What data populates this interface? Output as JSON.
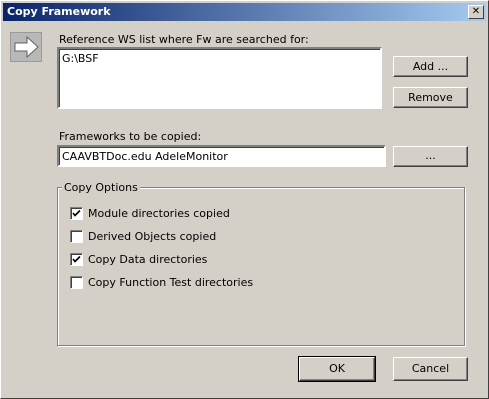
{
  "window": {
    "title": "Copy Framework",
    "close_glyph": "✕"
  },
  "reference": {
    "label": "Reference WS list where Fw are searched for:",
    "entries": [
      "G:\\BSF"
    ],
    "add_button": "Add ...",
    "remove_button": "Remove"
  },
  "frameworks": {
    "label": "Frameworks to be copied:",
    "value": "CAAVBTDoc.edu AdeleMonitor",
    "browse_button": "..."
  },
  "copy_options": {
    "label": "Copy Options",
    "items": [
      {
        "label": "Module directories copied",
        "checked": true
      },
      {
        "label": "Derived Objects copied",
        "checked": false
      },
      {
        "label": "Copy Data directories",
        "checked": true
      },
      {
        "label": "Copy Function Test directories",
        "checked": false
      }
    ]
  },
  "footer": {
    "ok_button": "OK",
    "cancel_button": "Cancel"
  },
  "icons": {
    "header_icon": "arrow-right-icon",
    "close": "close-icon",
    "check": "checkmark-icon"
  },
  "colors": {
    "face": "#d4d0c8",
    "title_start": "#0a246a",
    "title_end": "#a6caf0",
    "field": "#ffffff"
  }
}
